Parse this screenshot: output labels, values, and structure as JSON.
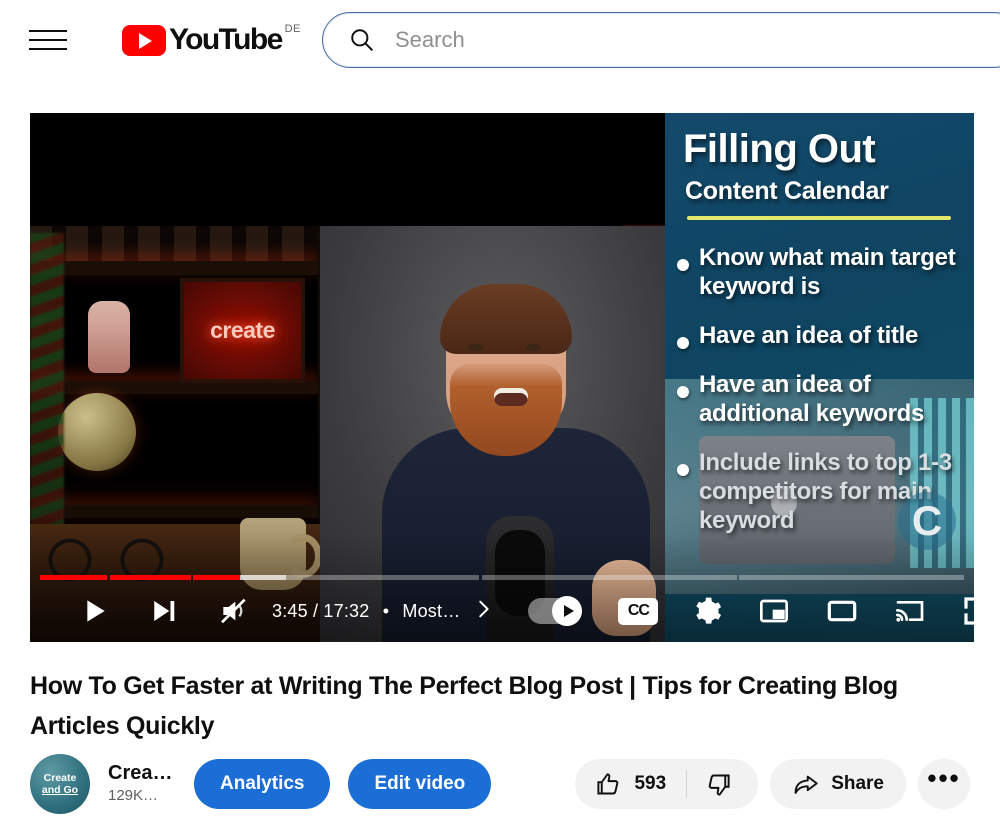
{
  "masthead": {
    "menu_icon": "hamburger-menu-icon",
    "logo_text": "YouTube",
    "country_code": "DE",
    "search": {
      "placeholder": "Search",
      "value": "",
      "icon": "search-icon"
    }
  },
  "player": {
    "time_display": "3:45 / 17:32",
    "separator": "•",
    "chapter_label": "Most…",
    "chapter_chevron": "chevron-right-icon",
    "current_time": "3:45",
    "duration": "17:32",
    "progress_percent": 21.4,
    "buffered_percent": 26.5,
    "chapters": [
      {
        "start_percent": 0,
        "end_percent": 7.3
      },
      {
        "start_percent": 7.6,
        "end_percent": 16.3
      },
      {
        "start_percent": 16.6,
        "end_percent": 47.5
      },
      {
        "start_percent": 47.8,
        "end_percent": 75.4
      },
      {
        "start_percent": 75.7,
        "end_percent": 100
      }
    ],
    "controls": {
      "play_icon": "play-icon",
      "next_icon": "next-track-icon",
      "mute_icon": "volume-muted-icon",
      "autoplay_toggle": "autoplay-toggle",
      "autoplay_on": true,
      "cc_label": "CC",
      "settings_icon": "gear-icon",
      "miniplayer_icon": "miniplayer-icon",
      "theater_icon": "theater-mode-icon",
      "cast_icon": "cast-icon",
      "fullscreen_icon": "fullscreen-icon"
    },
    "slide": {
      "title": "Filling Out",
      "subtitle": "Content Calendar",
      "accent_color": "#e3e86a",
      "background_color": "#13496b",
      "bullets": [
        {
          "text": "Know what main target keyword is",
          "dim": false
        },
        {
          "text": "Have an idea of title",
          "dim": false
        },
        {
          "text": "Have an idea of additional keywords",
          "dim": false
        },
        {
          "text": "Include links to top 1-3 competitors for main keyword",
          "dim": true
        }
      ],
      "watermark": "C"
    },
    "set": {
      "neon_sign_text": "create"
    }
  },
  "video": {
    "title": "How To Get Faster at Writing The Perfect Blog Post | Tips for Creating Blog Articles Quickly"
  },
  "channel": {
    "avatar_line1": "Create",
    "avatar_line2": "and Go",
    "name": "Crea…",
    "subscribers": "129K…"
  },
  "actions": {
    "analytics_label": "Analytics",
    "edit_video_label": "Edit video",
    "primary_color": "#1b6ed6",
    "like_count": "593",
    "like_icon": "thumbs-up-icon",
    "dislike_icon": "thumbs-down-icon",
    "share_label": "Share",
    "share_icon": "share-arrow-icon",
    "more_label": "•••",
    "more_icon": "more-horizontal-icon"
  }
}
